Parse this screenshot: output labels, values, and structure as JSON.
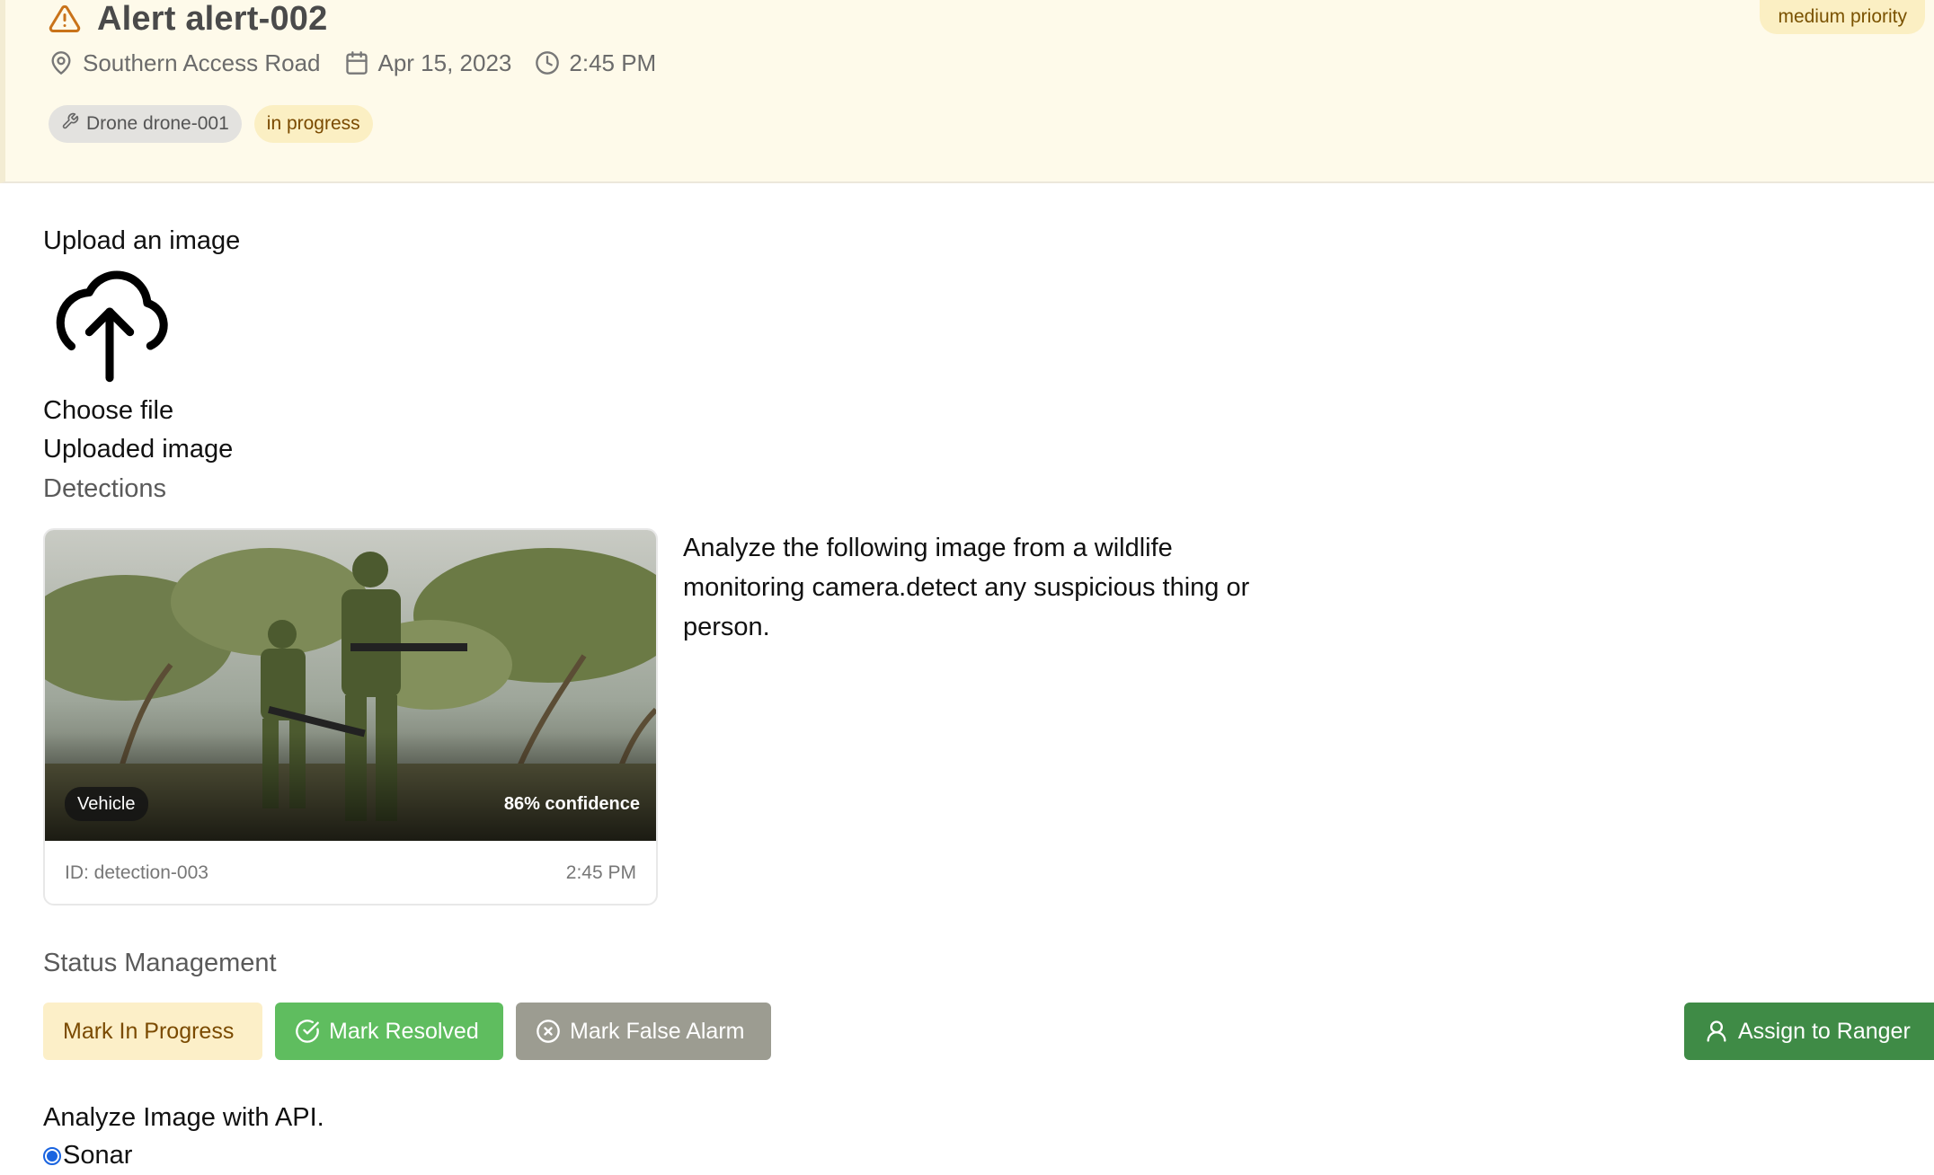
{
  "alert": {
    "title": "Alert alert-002",
    "priority": "medium priority",
    "location": "Southern Access Road",
    "date": "Apr 15, 2023",
    "time": "2:45 PM",
    "drone": "Drone drone-001",
    "status": "in progress"
  },
  "upload": {
    "label": "Upload an image",
    "choose_file": "Choose file",
    "uploaded_label": "Uploaded image"
  },
  "detections": {
    "heading": "Detections",
    "items": [
      {
        "label": "Vehicle",
        "confidence": "86% confidence",
        "id": "ID: detection-003",
        "time": "2:45 PM"
      }
    ],
    "prompt": "Analyze the following image from a wildlife monitoring camera.detect any suspicious thing or person."
  },
  "status_management": {
    "heading": "Status Management",
    "mark_in_progress": "Mark In Progress",
    "mark_resolved": "Mark Resolved",
    "mark_false_alarm": "Mark False Alarm",
    "assign_ranger": "Assign to Ranger"
  },
  "analyze": {
    "label": "Analyze Image with API.",
    "option_selected": "Sonar"
  },
  "colors": {
    "header_bg": "#fefaea",
    "warning": "#c9731a",
    "resolved": "#5fbd5f",
    "false_alarm": "#9c9c91",
    "assign": "#3f8b46",
    "in_progress_bg": "#fcefc8"
  },
  "icons": {
    "alert": "warning-triangle-icon",
    "location": "map-pin-icon",
    "date": "calendar-icon",
    "time": "clock-icon",
    "drone": "wrench-icon",
    "upload": "cloud-upload-icon",
    "resolved": "check-circle-icon",
    "false_alarm": "x-circle-icon",
    "assign": "user-icon"
  }
}
